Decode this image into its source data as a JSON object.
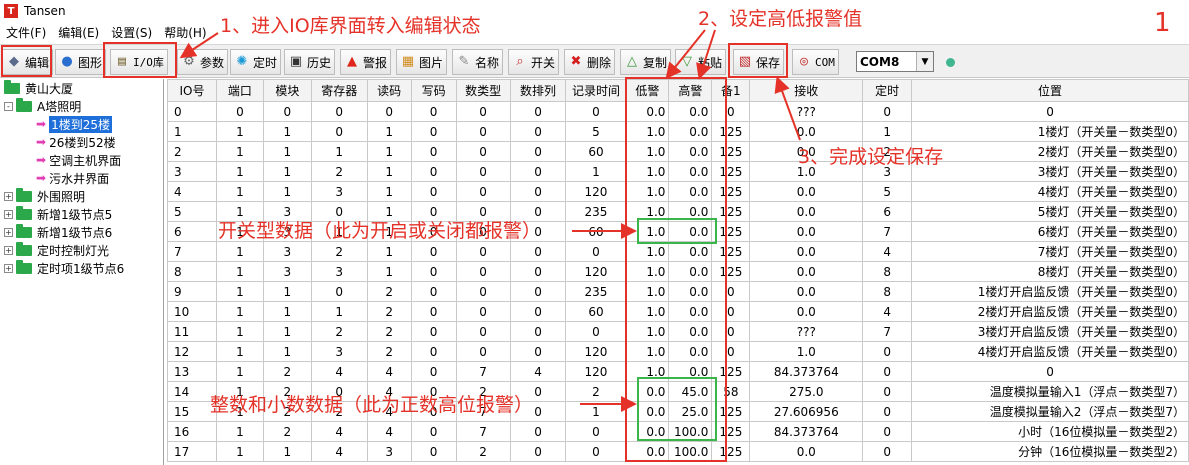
{
  "window": {
    "title": "Tansen",
    "app_icon": "T"
  },
  "menu": [
    "文件(F)",
    "编辑(E)",
    "设置(S)",
    "帮助(H)"
  ],
  "toolbar": {
    "buttons": [
      {
        "label": "编辑",
        "icon": "edit-icon"
      },
      {
        "label": "图形",
        "icon": "globe-icon"
      },
      {
        "label": "I/O库",
        "icon": "database-icon"
      },
      {
        "label": "参数",
        "icon": "gear-icon"
      },
      {
        "label": "定时",
        "icon": "timer-icon"
      },
      {
        "label": "历史",
        "icon": "monitor-icon"
      },
      {
        "label": "警报",
        "icon": "alarm-icon"
      },
      {
        "label": "图片",
        "icon": "picture-icon"
      },
      {
        "label": "名称",
        "icon": "name-icon"
      },
      {
        "label": "开关",
        "icon": "switch-icon"
      },
      {
        "label": "删除",
        "icon": "delete-icon"
      },
      {
        "label": "复制",
        "icon": "copy-icon"
      },
      {
        "label": "粘贴",
        "icon": "paste-icon"
      },
      {
        "label": "保存",
        "icon": "save-icon"
      },
      {
        "label": "COM",
        "icon": "port-icon"
      }
    ],
    "com_port": "COM8"
  },
  "tree": {
    "items": [
      {
        "label": "黄山大厦",
        "kind": "root"
      },
      {
        "label": "A塔照明",
        "kind": "group",
        "expander": "-"
      },
      {
        "label": "1楼到25楼",
        "kind": "leaf",
        "selected": true
      },
      {
        "label": "26楼到52楼",
        "kind": "leaf"
      },
      {
        "label": "空调主机界面",
        "kind": "leaf"
      },
      {
        "label": "污水井界面",
        "kind": "leaf"
      },
      {
        "label": "外围照明",
        "kind": "group",
        "expander": "+"
      },
      {
        "label": "新增1级节点5",
        "kind": "group",
        "expander": "+"
      },
      {
        "label": "新增1级节点6",
        "kind": "group",
        "expander": "+"
      },
      {
        "label": "定时控制灯光",
        "kind": "group",
        "expander": "+"
      },
      {
        "label": "定时项1级节点6",
        "kind": "group",
        "expander": "+"
      }
    ]
  },
  "table": {
    "headers": [
      "IO号",
      "端口",
      "模块",
      "寄存器",
      "读码",
      "写码",
      "数类型",
      "数排列",
      "记录时间",
      "低警",
      "高警",
      "备1",
      "接收",
      "定时",
      "位置"
    ],
    "rows": [
      [
        "0",
        "0",
        "0",
        "0",
        "0",
        "0",
        "0",
        "0",
        "0",
        "0.0",
        "0.0",
        "0",
        "???",
        "0",
        "0"
      ],
      [
        "1",
        "1",
        "1",
        "0",
        "1",
        "0",
        "0",
        "0",
        "5",
        "1.0",
        "0.0",
        "125",
        "0.0",
        "1",
        "1楼灯（开关量－数类型0）"
      ],
      [
        "2",
        "1",
        "1",
        "1",
        "1",
        "0",
        "0",
        "0",
        "60",
        "1.0",
        "0.0",
        "125",
        "0.0",
        "2",
        "2楼灯（开关量－数类型0）"
      ],
      [
        "3",
        "1",
        "1",
        "2",
        "1",
        "0",
        "0",
        "0",
        "1",
        "1.0",
        "0.0",
        "125",
        "1.0",
        "3",
        "3楼灯（开关量－数类型0）"
      ],
      [
        "4",
        "1",
        "1",
        "3",
        "1",
        "0",
        "0",
        "0",
        "120",
        "1.0",
        "0.0",
        "125",
        "0.0",
        "5",
        "4楼灯（开关量－数类型0）"
      ],
      [
        "5",
        "1",
        "3",
        "0",
        "1",
        "0",
        "0",
        "0",
        "235",
        "1.0",
        "0.0",
        "125",
        "0.0",
        "6",
        "5楼灯（开关量－数类型0）"
      ],
      [
        "6",
        "1",
        "3",
        "1",
        "1",
        "0",
        "0",
        "0",
        "60",
        "1.0",
        "0.0",
        "125",
        "0.0",
        "7",
        "6楼灯（开关量－数类型0）"
      ],
      [
        "7",
        "1",
        "3",
        "2",
        "1",
        "0",
        "0",
        "0",
        "0",
        "1.0",
        "0.0",
        "125",
        "0.0",
        "4",
        "7楼灯（开关量－数类型0）"
      ],
      [
        "8",
        "1",
        "3",
        "3",
        "1",
        "0",
        "0",
        "0",
        "120",
        "1.0",
        "0.0",
        "125",
        "0.0",
        "8",
        "8楼灯（开关量－数类型0）"
      ],
      [
        "9",
        "1",
        "1",
        "0",
        "2",
        "0",
        "0",
        "0",
        "235",
        "1.0",
        "0.0",
        "0",
        "0.0",
        "8",
        "1楼灯开启监反馈（开关量－数类型0）"
      ],
      [
        "10",
        "1",
        "1",
        "1",
        "2",
        "0",
        "0",
        "0",
        "60",
        "1.0",
        "0.0",
        "0",
        "0.0",
        "4",
        "2楼灯开启监反馈（开关量－数类型0）"
      ],
      [
        "11",
        "1",
        "1",
        "2",
        "2",
        "0",
        "0",
        "0",
        "0",
        "1.0",
        "0.0",
        "0",
        "???",
        "7",
        "3楼灯开启监反馈（开关量－数类型0）"
      ],
      [
        "12",
        "1",
        "1",
        "3",
        "2",
        "0",
        "0",
        "0",
        "120",
        "1.0",
        "0.0",
        "0",
        "1.0",
        "0",
        "4楼灯开启监反馈（开关量－数类型0）"
      ],
      [
        "13",
        "1",
        "2",
        "4",
        "4",
        "0",
        "7",
        "4",
        "120",
        "1.0",
        "0.0",
        "125",
        "84.373764",
        "0",
        "0"
      ],
      [
        "14",
        "1",
        "2",
        "0",
        "4",
        "0",
        "2",
        "0",
        "2",
        "0.0",
        "45.0",
        "58",
        "275.0",
        "0",
        "温度模拟量输入1（浮点－数类型7）"
      ],
      [
        "15",
        "1",
        "2",
        "2",
        "4",
        "0",
        "7",
        "0",
        "1",
        "0.0",
        "25.0",
        "125",
        "27.606956",
        "0",
        "温度模拟量输入2（浮点－数类型7）"
      ],
      [
        "16",
        "1",
        "2",
        "4",
        "4",
        "0",
        "7",
        "0",
        "0",
        "0.0",
        "100.0",
        "125",
        "84.373764",
        "0",
        "小时（16位模拟量－数类型2）"
      ],
      [
        "17",
        "1",
        "1",
        "4",
        "3",
        "0",
        "2",
        "0",
        "0",
        "0.0",
        "100.0",
        "125",
        "0.0",
        "0",
        "分钟（16位模拟量－数类型2）"
      ]
    ]
  },
  "annotations": {
    "step1": "1、进入IO库界面转入编辑状态",
    "step2": "2、设定高低报警值",
    "step3": "3、完成设定保存",
    "switch_note": "开关型数据（此为开启或关闭都报警）",
    "number_note": "整数和小数数据（此为正数高位报警）",
    "corner_number": "1"
  },
  "colors": {
    "annotation": "#e53228",
    "highlight": "#3ab54a",
    "selection": "#1e6fd9"
  }
}
